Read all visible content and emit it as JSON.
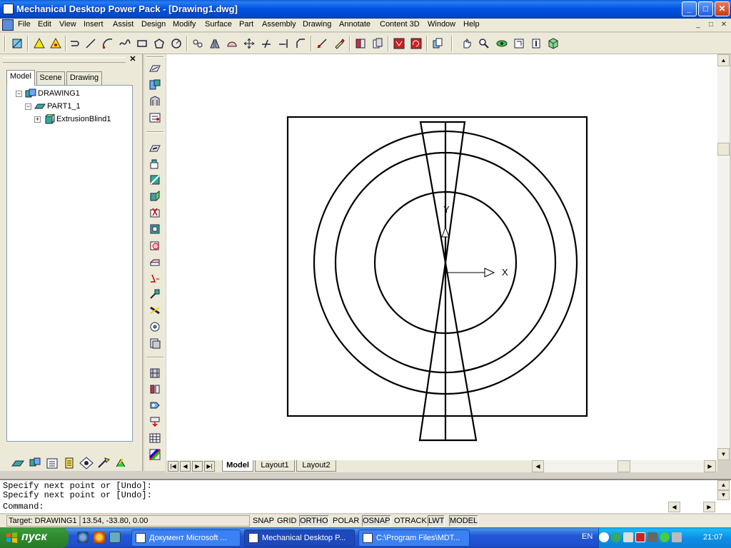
{
  "window": {
    "title": "Mechanical Desktop Power Pack - [Drawing1.dwg]",
    "min": "_",
    "max": "□",
    "close": "✕"
  },
  "menu": [
    "File",
    "Edit",
    "View",
    "Insert",
    "Assist",
    "Design",
    "Modify",
    "Surface",
    "Part",
    "Assembly",
    "Drawing",
    "Annotate",
    "Content 3D",
    "Window",
    "Help"
  ],
  "mdi_controls": [
    "_",
    "□",
    "✕"
  ],
  "browser": {
    "close": "✕",
    "tabs": [
      "Model",
      "Scene",
      "Drawing"
    ],
    "tree": [
      {
        "label": "DRAWING1",
        "expander": "−"
      },
      {
        "label": "PART1_1",
        "expander": "−"
      },
      {
        "label": "ExtrusionBlind1",
        "expander": "+"
      }
    ]
  },
  "drawing": {
    "ucs_x_label": "X",
    "ucs_y_label": "Y",
    "layout_tabs": [
      "Model",
      "Layout1",
      "Layout2"
    ],
    "nav_buttons": [
      "|◀",
      "◀",
      "▶",
      "▶|"
    ]
  },
  "command": {
    "lines": [
      "Specify next point or [Undo]:",
      "Specify next point or [Undo]:",
      "Command:"
    ]
  },
  "status": {
    "target": "Target: DRAWING1",
    "coords": "13.54, -33.80, 0.00",
    "toggles": [
      {
        "label": "SNAP",
        "on": false
      },
      {
        "label": "GRID",
        "on": false
      },
      {
        "label": "ORTHO",
        "on": true
      },
      {
        "label": "POLAR",
        "on": false
      },
      {
        "label": "OSNAP",
        "on": true
      },
      {
        "label": "OTRACK",
        "on": false
      },
      {
        "label": "LWT",
        "on": true
      },
      {
        "label": "MODEL",
        "on": true
      }
    ]
  },
  "taskbar": {
    "start": "пуск",
    "tasks": [
      {
        "label": "Документ Microsoft ...",
        "active": false
      },
      {
        "label": "Mechanical Desktop P...",
        "active": true
      },
      {
        "label": "C:\\Program Files\\MDT...",
        "active": false
      }
    ],
    "lang": "EN",
    "clock": "21:07",
    "tray_icons": [
      "back-arrow-icon",
      "network-icon",
      "audio-icon",
      "ati-icon",
      "monitor-icon",
      "antivirus-icon",
      "speaker-icon"
    ]
  },
  "colors": {
    "titlebar": "#0054e3",
    "canvas": "#ffffff",
    "taskbar": "#245edb",
    "start": "#2f8a2f"
  }
}
